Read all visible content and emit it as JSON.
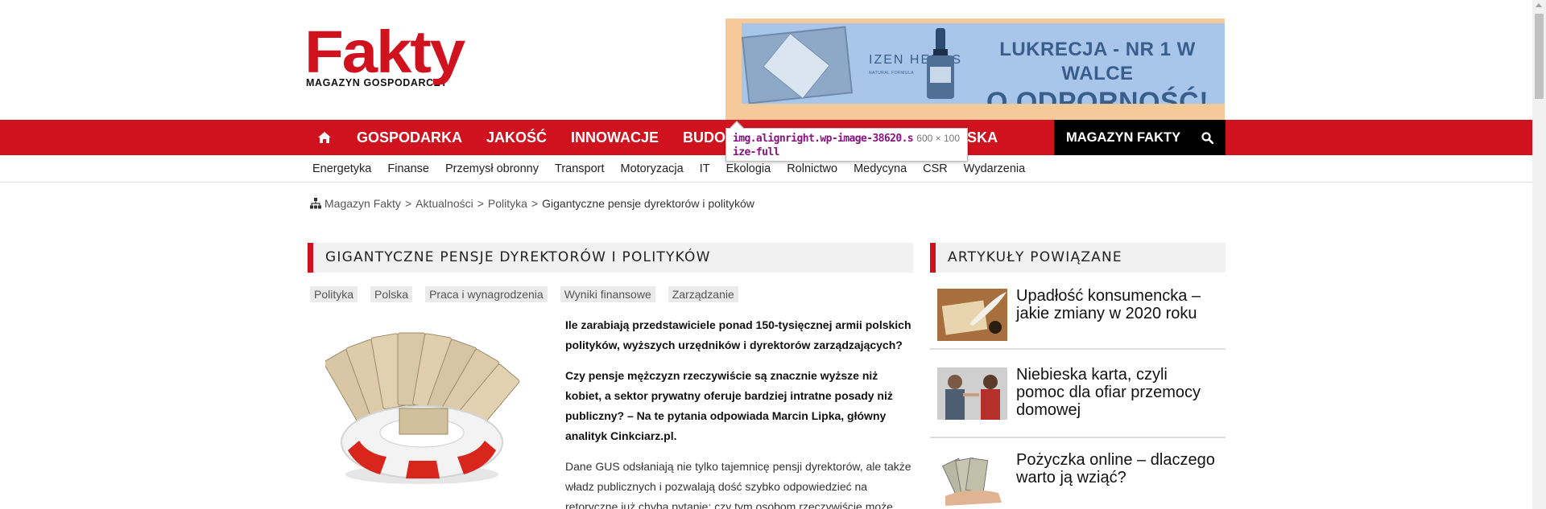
{
  "logo": {
    "main": "Fakty",
    "sub": "MAGAZYN GOSPODARCZY"
  },
  "banner": {
    "brand": "IZEN HERBS",
    "brand_sub": "NATURAL FORMULA",
    "line1": "LUKRECJA - NR 1 W WALCE",
    "line2": "O ODPORNOŚĆ!"
  },
  "nav": {
    "items": [
      "GOSPODARKA",
      "JAKOŚĆ",
      "INNOWACJE",
      "BUDOWNIC",
      "JSKA"
    ],
    "magazine": "MAGAZYN FAKTY"
  },
  "tooltip": {
    "selector": "img.alignright.wp-image-38620.size-full",
    "size": "600 × 100"
  },
  "subnav": [
    "Energetyka",
    "Finanse",
    "Przemysł obronny",
    "Transport",
    "Motoryzacja",
    "IT",
    "Ekologia",
    "Rolnictwo",
    "Medycyna",
    "CSR",
    "Wydarzenia"
  ],
  "breadcrumb": {
    "items": [
      "Magazyn Fakty",
      "Aktualności",
      "Polityka"
    ],
    "separator": ">",
    "current": "Gigantyczne pensje dyrektorów i polityków"
  },
  "article": {
    "title": "GIGANTYCZNE PENSJE DYREKTORÓW I POLITYKÓW",
    "tags": [
      "Polityka",
      "Polska",
      "Praca i wynagrodzenia",
      "Wyniki finansowe",
      "Zarządzanie"
    ],
    "lead1": "Ile zarabiają przedstawiciele ponad 150-tysięcznej armii polskich polityków, wyższych urzędników i dyrektorów zarządzających?",
    "lead2": "Czy pensje mężczyzn rzeczywiście są znacznie wyższe niż kobiet, a sektor prywatny oferuje bardziej intratne posady niż publiczny? – Na te pytania odpowiada Marcin Lipka, główny analityk Cinkciarz.pl.",
    "body": "Dane GUS odsłaniają nie tylko tajemnicę pensji dyrektorów, ale także władz publicznych i pozwalają dość szybko odpowiedzieć na retoryczne już chyba pytanie: czy tym osobom rzeczywiście może"
  },
  "sidebar": {
    "title": "ARTYKUŁY POWIĄZANE",
    "items": [
      {
        "title": "Upadłość konsumencka – jakie zmiany w 2020 roku"
      },
      {
        "title": "Niebieska karta, czyli pomoc dla ofiar przemocy domowej"
      },
      {
        "title": "Pożyczka online – dlaczego warto ją wziąć?"
      }
    ]
  },
  "colors": {
    "brand_red": "#d0121f",
    "nav_black": "#000000",
    "banner_bg": "#a7c6e9",
    "banner_frame": "#f6c99b"
  }
}
